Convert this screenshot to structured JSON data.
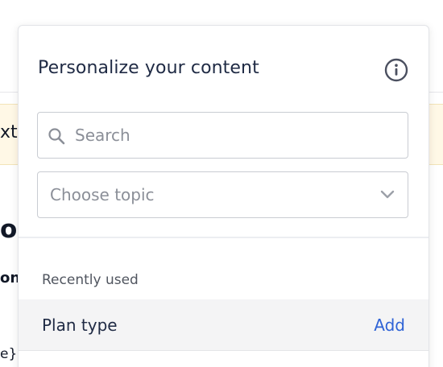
{
  "background": {
    "fragment_1": "xt",
    "fragment_2": "on",
    "fragment_3": "on",
    "fragment_4": "e}}"
  },
  "popover": {
    "title": "Personalize your content",
    "info_icon": "info-circle-icon",
    "search": {
      "placeholder": "Search",
      "value": "",
      "icon": "search-icon"
    },
    "topic_select": {
      "placeholder": "Choose topic",
      "icon": "chevron-down-icon"
    },
    "recently_used": {
      "label": "Recently used",
      "items": [
        {
          "label": "Plan type",
          "action": "Add"
        }
      ]
    }
  },
  "colors": {
    "accent": "#2f63d6",
    "banner": "#fff8e6",
    "text": "#1f2a44",
    "muted": "#8b8f98",
    "item_bg": "#f4f4f5"
  }
}
